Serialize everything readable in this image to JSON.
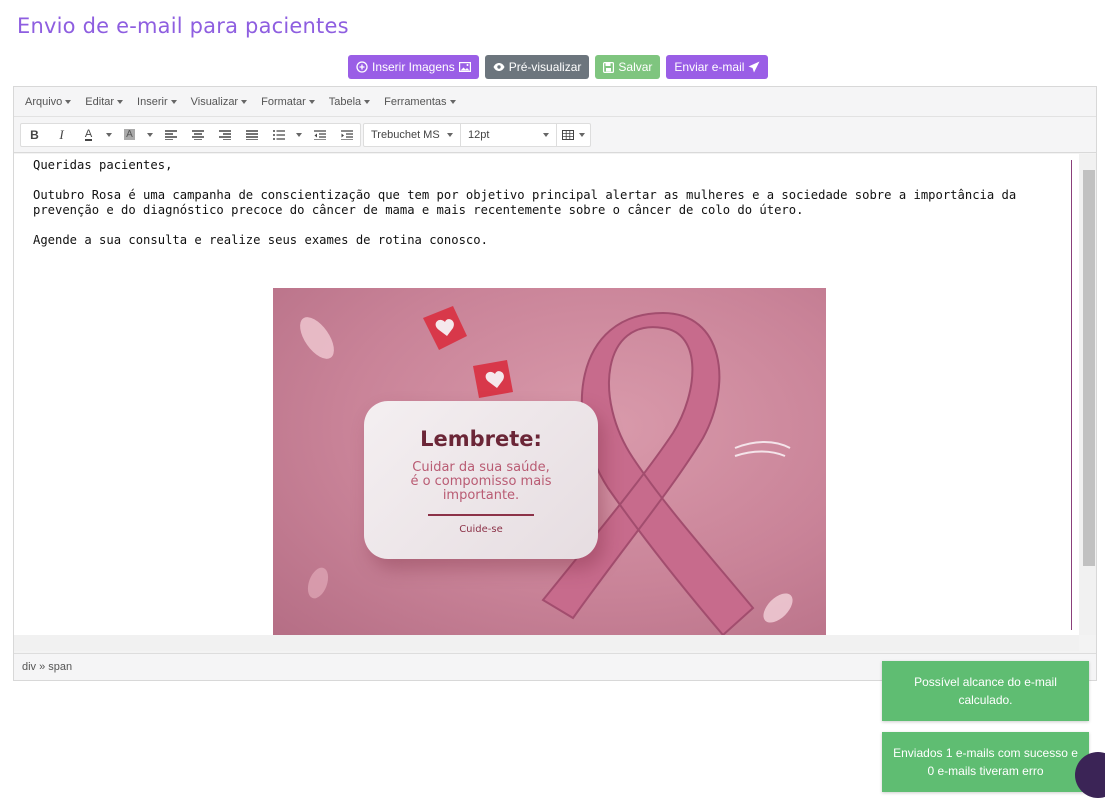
{
  "page": {
    "title": "Envio de e-mail para pacientes"
  },
  "actions": {
    "insert_images": "Inserir Imagens",
    "preview": "Pré-visualizar",
    "save": "Salvar",
    "send": "Enviar e-mail"
  },
  "menubar": [
    "Arquivo",
    "Editar",
    "Inserir",
    "Visualizar",
    "Formatar",
    "Tabela",
    "Ferramentas"
  ],
  "toolbar": {
    "font_family": "Trebuchet MS",
    "font_size": "12pt"
  },
  "document": {
    "greeting": "Queridas pacientes,",
    "paragraph1": "Outubro Rosa é uma campanha de conscientização que tem por objetivo principal alertar as mulheres e a sociedade sobre a importância da prevenção e do diagnóstico precoce do câncer de mama e mais recentemente sobre o câncer de colo do útero.",
    "paragraph2": "Agende a sua consulta e realize seus exames de rotina conosco.",
    "image": {
      "heading": "Lembrete:",
      "body_line1": "Cuidar da sua saúde,",
      "body_line2": "é o compomisso mais",
      "body_line3": "importante.",
      "signature": "Cuide-se"
    }
  },
  "statusbar": {
    "path": "div » span"
  },
  "toasts": [
    "Possível alcance do e-mail calculado.",
    "Enviados 1 e-mails com sucesso e 0 e-mails tiveram erro"
  ],
  "colors": {
    "accent": "#9a5ee6",
    "success": "#5fbd72",
    "secondary": "#6c757d"
  }
}
